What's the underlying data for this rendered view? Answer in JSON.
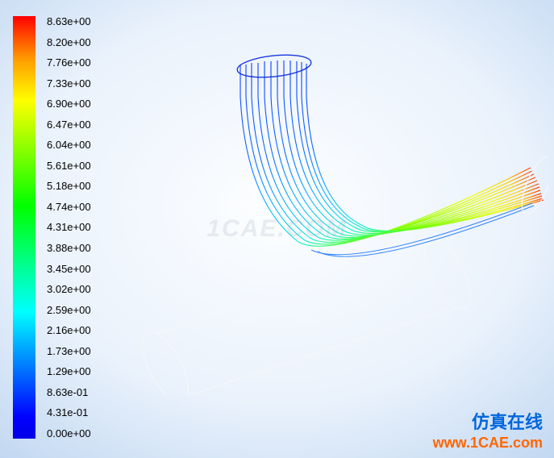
{
  "legend": {
    "labels": [
      "8.63e+00",
      "8.20e+00",
      "7.76e+00",
      "7.33e+00",
      "6.90e+00",
      "6.47e+00",
      "6.04e+00",
      "5.61e+00",
      "5.18e+00",
      "4.74e+00",
      "4.31e+00",
      "3.88e+00",
      "3.45e+00",
      "3.02e+00",
      "2.59e+00",
      "2.16e+00",
      "1.73e+00",
      "1.29e+00",
      "8.63e-01",
      "4.31e-01",
      "0.00e+00"
    ]
  },
  "watermark": {
    "chinese": "仿真在线",
    "url": "www.1CAE.com",
    "center": "1CAE.COM"
  },
  "chart_data": {
    "type": "cfd_pathlines",
    "variable": "velocity_magnitude",
    "unit": "unknown",
    "min": 0.0,
    "max": 8.63,
    "levels": [
      8.63,
      8.2,
      7.76,
      7.33,
      6.9,
      6.47,
      6.04,
      5.61,
      5.18,
      4.74,
      4.31,
      3.88,
      3.45,
      3.02,
      2.59,
      2.16,
      1.73,
      1.29,
      0.863,
      0.431,
      0.0
    ],
    "colormap": "rainbow (blue-low → red-high)",
    "geometry": "tee-branch pipe junction with 90° elbow; inlet at top (blue/low), flow turns through elbow, exits to right (green→yellow→red/high); main through-pipe shown as wireframe only",
    "software_hint": "ANSYS Fluent / CFD contour plot"
  }
}
